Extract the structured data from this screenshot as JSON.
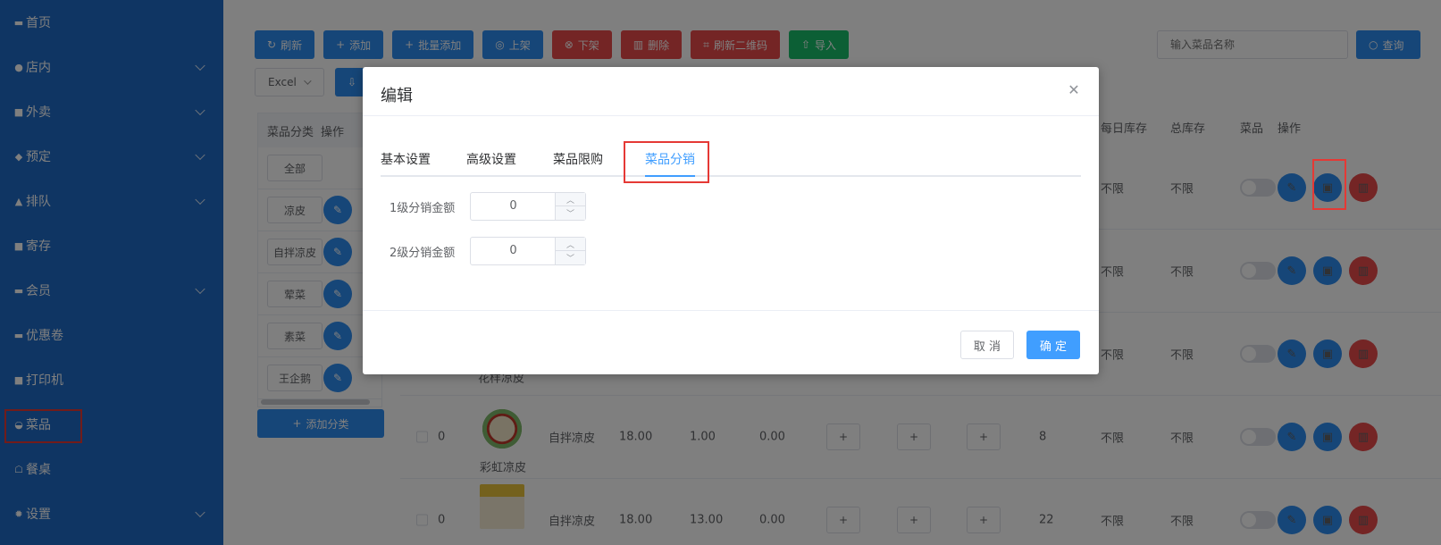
{
  "sidebar": {
    "items": [
      {
        "label": "首页",
        "icon": "home-icon",
        "chevron": false
      },
      {
        "label": "店内",
        "icon": "user-icon",
        "chevron": true
      },
      {
        "label": "外卖",
        "icon": "delivery-icon",
        "chevron": true
      },
      {
        "label": "预定",
        "icon": "gift-icon",
        "chevron": true
      },
      {
        "label": "排队",
        "icon": "queue-icon",
        "chevron": true
      },
      {
        "label": "寄存",
        "icon": "briefcase-icon",
        "chevron": false
      },
      {
        "label": "会员",
        "icon": "card-icon",
        "chevron": true
      },
      {
        "label": "优惠卷",
        "icon": "ticket-icon",
        "chevron": false
      },
      {
        "label": "打印机",
        "icon": "printer-icon",
        "chevron": false
      },
      {
        "label": "菜品",
        "icon": "dish-icon",
        "chevron": false,
        "active": true
      },
      {
        "label": "餐桌",
        "icon": "table-icon",
        "chevron": false
      },
      {
        "label": "设置",
        "icon": "gear-icon",
        "chevron": true
      }
    ]
  },
  "toolbar": {
    "refresh": "刷新",
    "add": "添加",
    "batch_add": "批量添加",
    "on_shelf": "上架",
    "off_shelf": "下架",
    "delete": "删除",
    "refresh_qr": "刷新二维码",
    "import": "导入",
    "search_placeholder": "输入菜品名称",
    "search": "查询",
    "excel": "Excel"
  },
  "categories": {
    "header_name": "菜品分类",
    "header_op": "操作",
    "items": [
      "全部",
      "凉皮",
      "自拌凉皮",
      "荤菜",
      "素菜",
      "王企鹅"
    ],
    "add_label": "添加分类"
  },
  "table": {
    "headers": [
      "每日库存",
      "总库存",
      "菜品",
      "操作"
    ],
    "rows": [
      {
        "daily": "不限",
        "total": "不限"
      },
      {
        "daily": "不限",
        "total": "不限"
      },
      {
        "name_tail": "花样凉皮",
        "daily": "不限",
        "total": "不限"
      },
      {
        "sort": "0",
        "name": "彩虹凉皮",
        "category": "自拌凉皮",
        "price": "18.00",
        "box": "1.00",
        "member": "0.00",
        "stock": "8",
        "daily": "不限",
        "total": "不限"
      },
      {
        "sort": "0",
        "category": "自拌凉皮",
        "price": "18.00",
        "box": "13.00",
        "member": "0.00",
        "stock": "22",
        "daily": "不限",
        "total": "不限"
      }
    ],
    "plus": "+"
  },
  "dialog": {
    "title": "编辑",
    "tabs": [
      "基本设置",
      "高级设置",
      "菜品限购",
      "菜品分销"
    ],
    "active_tab": 3,
    "fields": [
      {
        "label": "1级分销金额",
        "value": "0"
      },
      {
        "label": "2级分销金额",
        "value": "0"
      }
    ],
    "cancel": "取 消",
    "ok": "确 定"
  }
}
